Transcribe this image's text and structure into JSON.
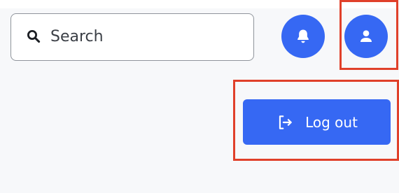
{
  "search": {
    "placeholder": "Search",
    "icon": "search-icon"
  },
  "header": {
    "notifications_icon": "bell-icon",
    "profile_icon": "user-icon"
  },
  "menu": {
    "logout_label": "Log out",
    "logout_icon": "sign-out-icon"
  },
  "colors": {
    "accent": "#3668f3",
    "highlight": "#e0402a",
    "background": "#f7f8fa"
  }
}
